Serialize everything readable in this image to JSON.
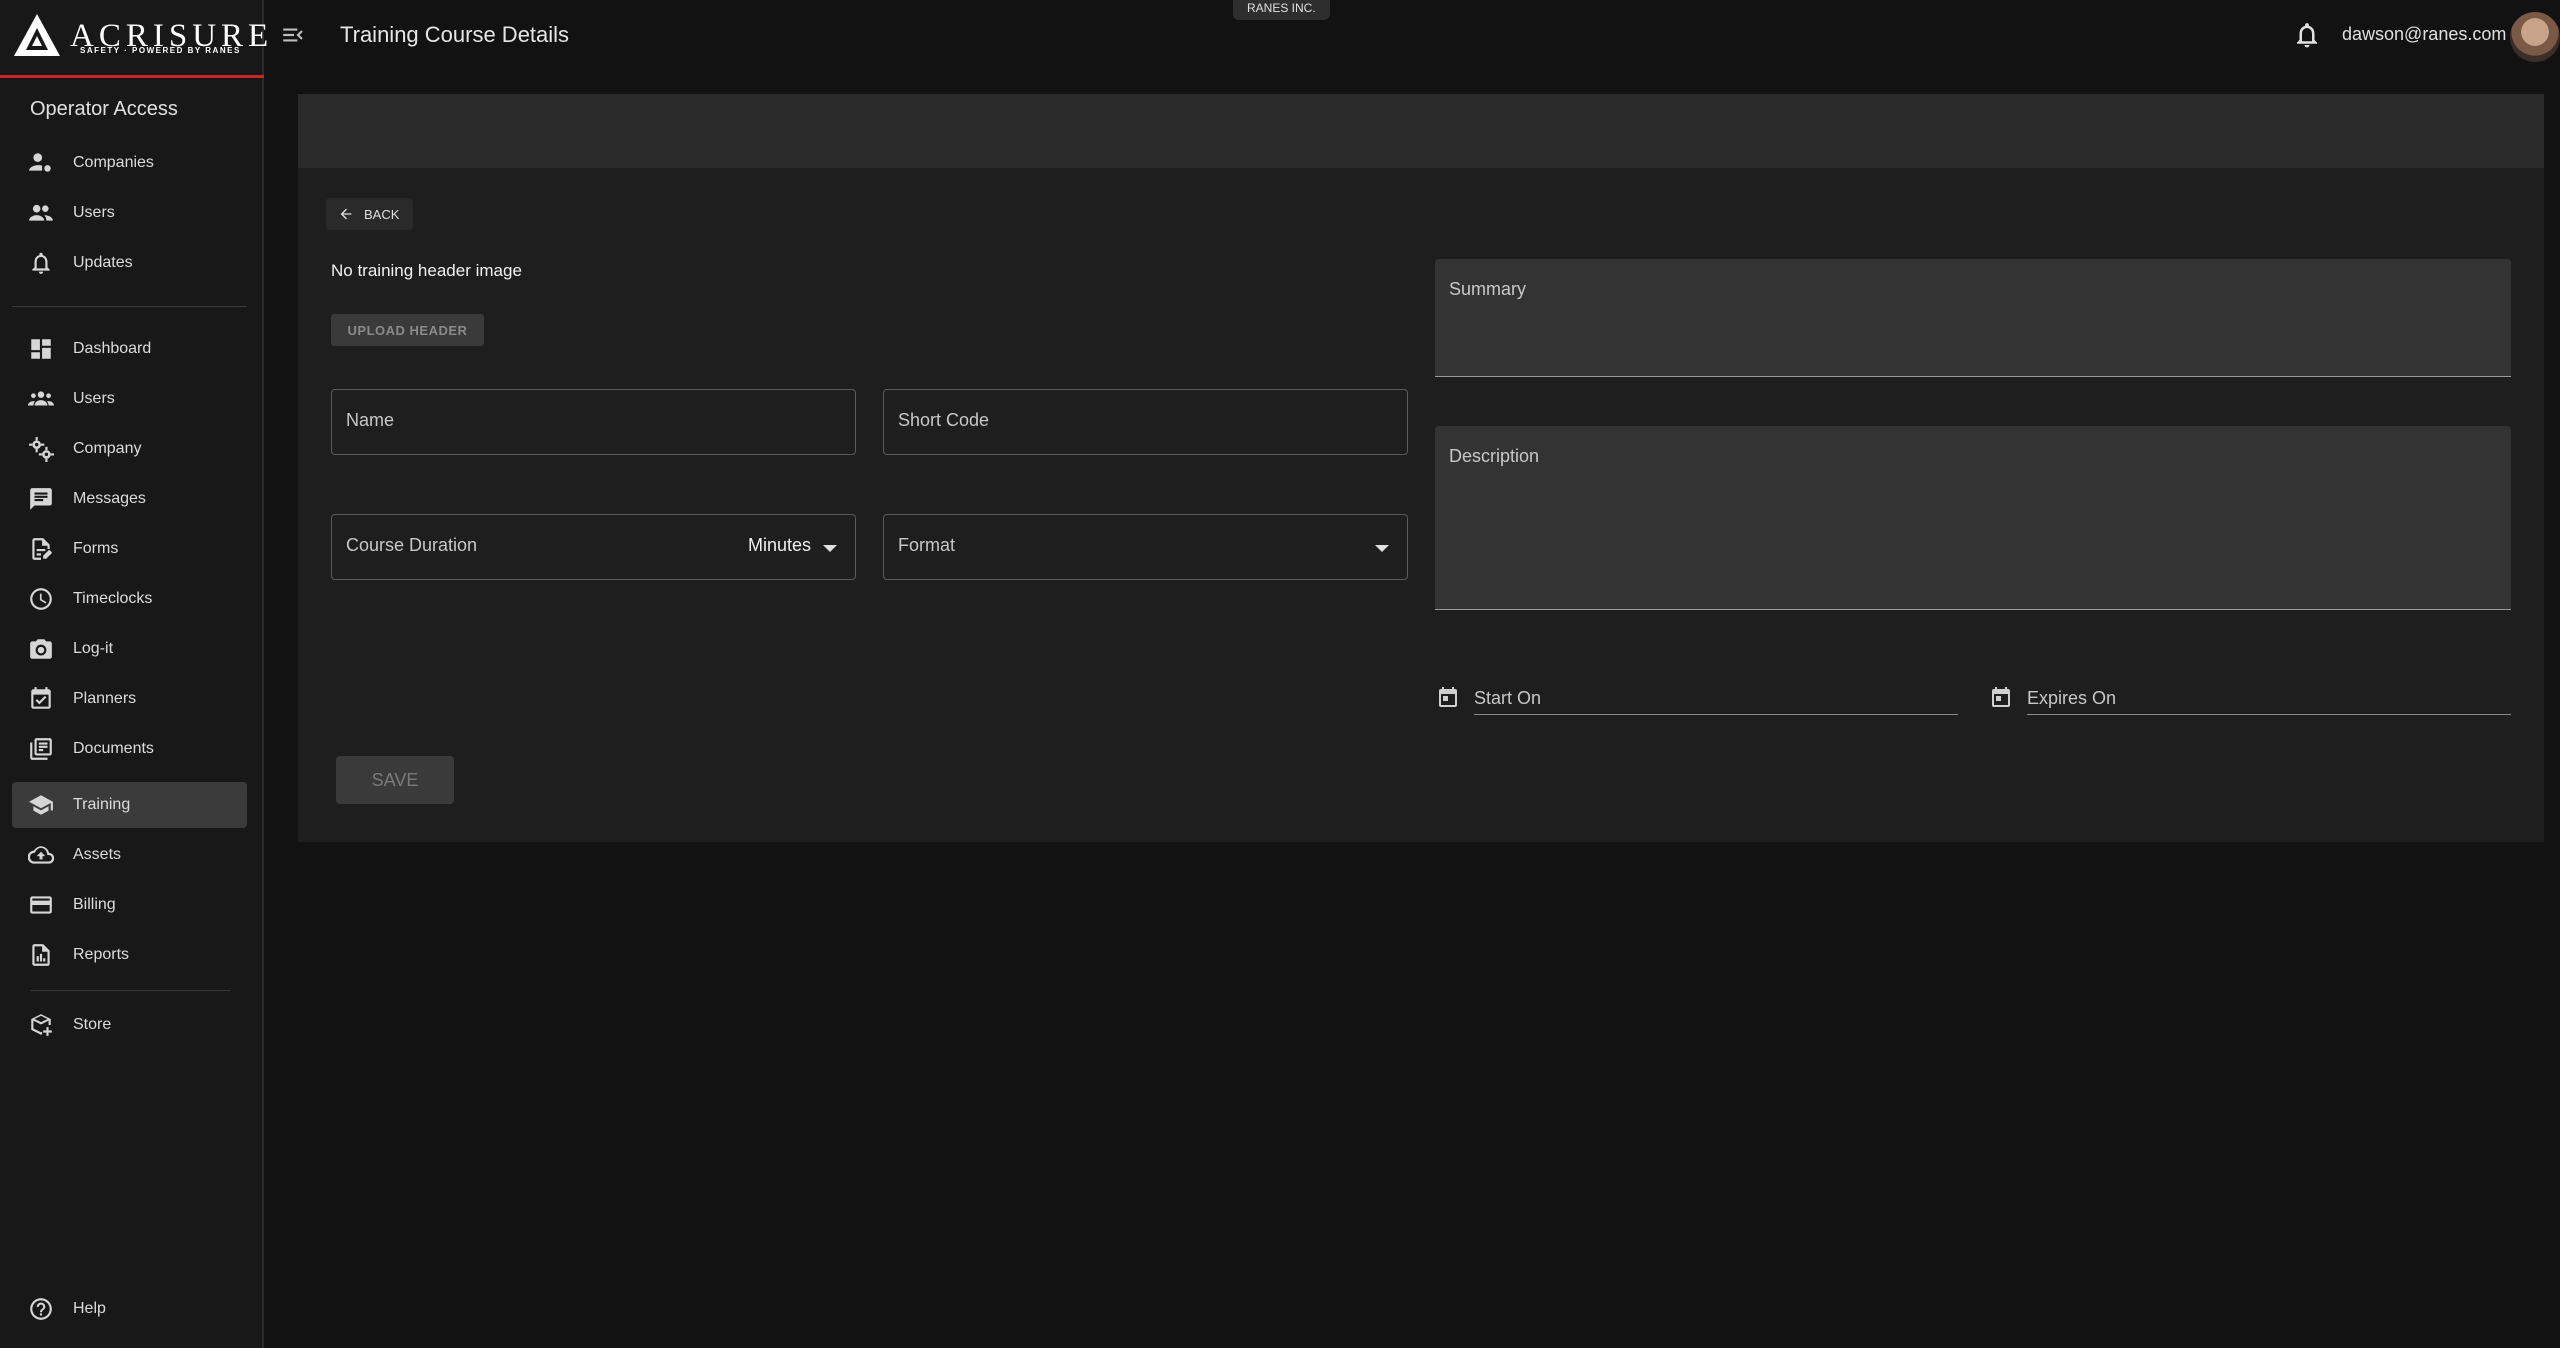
{
  "brand": {
    "name": "ACRISURE",
    "tagline": "SAFETY · POWERED BY RANES",
    "accent_color": "#c62828"
  },
  "sidebar": {
    "section_title": "Operator Access",
    "operator_items": [
      {
        "label": "Companies",
        "icon": "manage-accounts-icon"
      },
      {
        "label": "Users",
        "icon": "people-icon"
      },
      {
        "label": "Updates",
        "icon": "bell-icon"
      }
    ],
    "main_items": [
      {
        "label": "Dashboard",
        "icon": "dashboard-icon"
      },
      {
        "label": "Users",
        "icon": "groups-icon"
      },
      {
        "label": "Company",
        "icon": "gears-icon"
      },
      {
        "label": "Messages",
        "icon": "chat-icon"
      },
      {
        "label": "Forms",
        "icon": "edit-document-icon"
      },
      {
        "label": "Timeclocks",
        "icon": "clock-icon"
      },
      {
        "label": "Log-it",
        "icon": "camera-icon"
      },
      {
        "label": "Planners",
        "icon": "calendar-check-icon"
      },
      {
        "label": "Documents",
        "icon": "documents-icon"
      },
      {
        "label": "Training",
        "icon": "school-icon",
        "active": true
      },
      {
        "label": "Assets",
        "icon": "cloud-upload-icon"
      },
      {
        "label": "Billing",
        "icon": "credit-card-icon"
      },
      {
        "label": "Reports",
        "icon": "report-icon"
      }
    ],
    "store": {
      "label": "Store",
      "icon": "add-box-icon"
    },
    "help": {
      "label": "Help",
      "icon": "help-icon"
    }
  },
  "topbar": {
    "title": "Training Course Details",
    "company_chip": "RANES INC.",
    "user_email": "dawson@ranes.com"
  },
  "form": {
    "back_label": "BACK",
    "no_image_text": "No training header image",
    "upload_label": "UPLOAD HEADER",
    "name_placeholder": "Name",
    "short_code_placeholder": "Short Code",
    "course_duration_placeholder": "Course Duration",
    "duration_unit": "Minutes",
    "format_placeholder": "Format",
    "summary_placeholder": "Summary",
    "description_placeholder": "Description",
    "start_on_placeholder": "Start On",
    "expires_on_placeholder": "Expires On",
    "save_label": "SAVE"
  }
}
